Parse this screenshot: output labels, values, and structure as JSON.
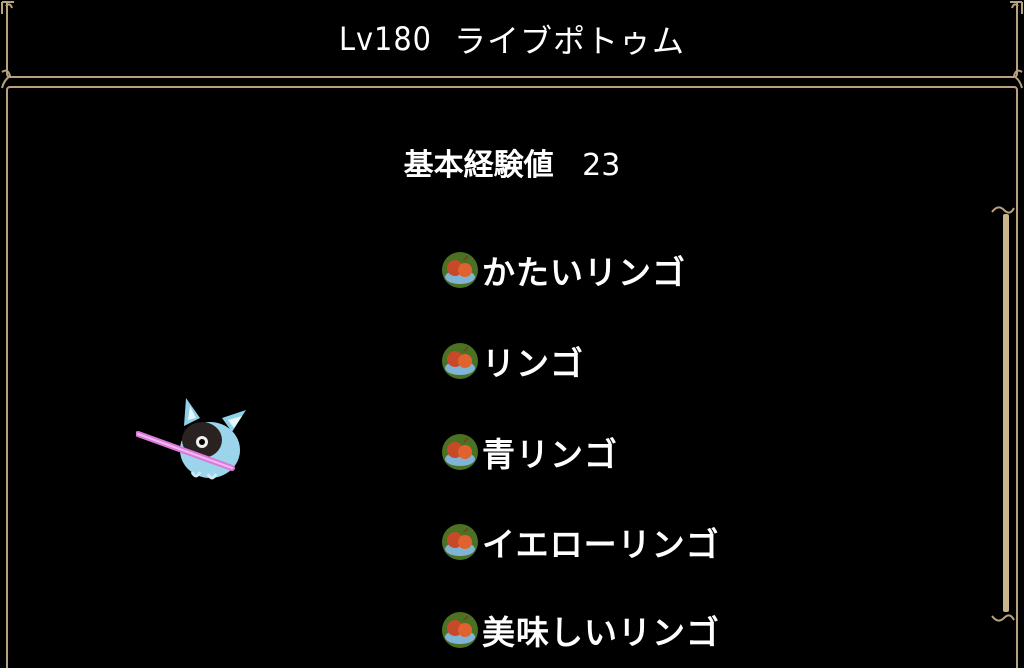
{
  "monster": {
    "level_label": "Lv180",
    "name": "ライブポトゥム"
  },
  "experience": {
    "label": "基本経験値",
    "value": "23"
  },
  "drops": [
    {
      "name": "かたいリンゴ",
      "icon": "apple-plate-icon"
    },
    {
      "name": "リンゴ",
      "icon": "apple-plate-icon"
    },
    {
      "name": "青リンゴ",
      "icon": "apple-plate-icon"
    },
    {
      "name": "イエローリンゴ",
      "icon": "apple-plate-icon"
    },
    {
      "name": "美味しいリンゴ",
      "icon": "apple-plate-icon"
    }
  ],
  "colors": {
    "background": "#000000",
    "frame": "#b7a27d",
    "text": "#ffffff",
    "item_glow": "#8fd14f",
    "apple": "#d9502a"
  }
}
